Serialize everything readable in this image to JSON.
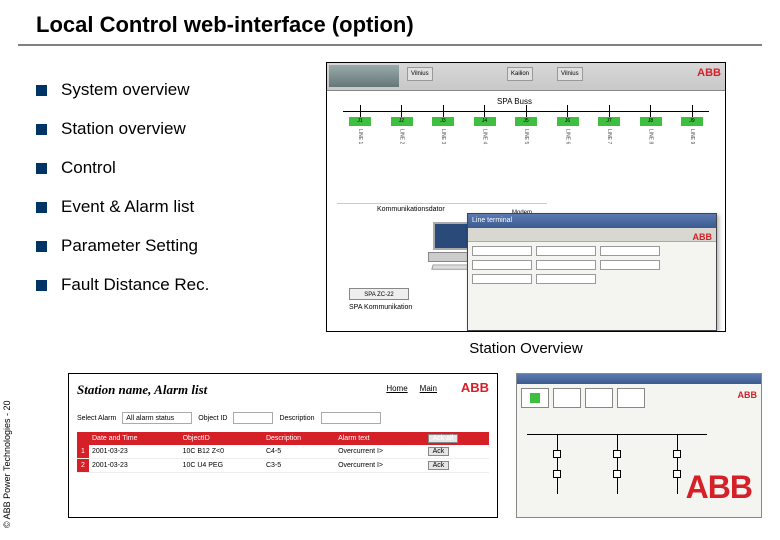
{
  "title": "Local Control web-interface (option)",
  "bullets": [
    "System overview",
    "Station overview",
    "Control",
    "Event & Alarm list",
    "Parameter Setting",
    "Fault Distance Rec."
  ],
  "diagram": {
    "bus_label": "SPA Buss",
    "header_buttons": [
      "Vilnius",
      "Kailion",
      "Vilnius"
    ],
    "feeder_nodes": [
      "J1",
      "J2",
      "J3",
      "J4",
      "J5",
      "J6",
      "J7",
      "J8",
      "J9"
    ],
    "feeder_labels": [
      "LINE 1",
      "LINE 2",
      "LINE 3",
      "LINE 4",
      "LINE 5",
      "LINE 6",
      "LINE 7",
      "LINE 8",
      "LINE 9"
    ],
    "comm_title": "Kommunikationsdator",
    "modem_label": "Modem",
    "spa_box": "SPA ZC-22",
    "spa_text": "SPA Kommunikation",
    "logo": "ABB"
  },
  "overlay": {
    "title": "Line terminal",
    "logo": "ABB"
  },
  "caption": "Station Overview",
  "alarm": {
    "title": "Station name, Alarm list",
    "links": [
      "Home",
      "Main"
    ],
    "logo": "ABB",
    "filter_labels": [
      "Select Alarm",
      "All alarm status",
      "Object ID",
      "Description"
    ],
    "columns": [
      "",
      "Date and Time",
      "ObjectID",
      "Description",
      "Alarm text",
      "Ack all"
    ],
    "rows": [
      {
        "idx": "1",
        "datetime": "2001-03-23",
        "obj": "10C B12 Z<0",
        "desc": "C4-5",
        "alarm": "Overcurrent I>",
        "ack": "Ack"
      },
      {
        "idx": "2",
        "datetime": "2001-03-23",
        "obj": "10C U4 PEG",
        "desc": "C3-5",
        "alarm": "Overcurrent I>",
        "ack": "Ack"
      }
    ]
  },
  "sld": {
    "logo": "ABB"
  },
  "copyright": "© ABB Power Technologies - 20",
  "footer_logo": "ABB"
}
